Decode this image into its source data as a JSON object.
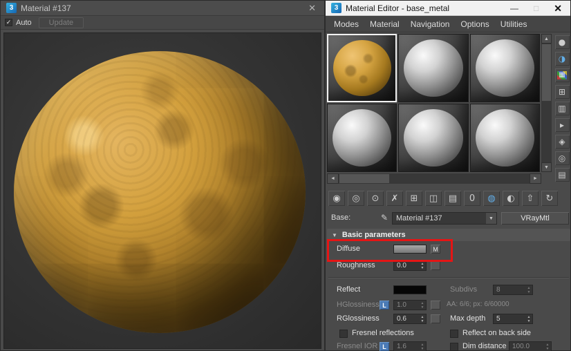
{
  "glyphs": {
    "up": "▲",
    "down": "▼",
    "left": "◄",
    "right": "►",
    "check": "✓",
    "close": "✕",
    "minimize": "—",
    "maximize": "□",
    "eyedropper": "✎",
    "rollout_arrow": "▼"
  },
  "colors": {
    "annotation_red": "#e51515",
    "lock_blue": "#4a7ab5",
    "logo_blue": "#1565b2",
    "sphere_orange": "#d3a03d"
  },
  "preview_window": {
    "logo": "3",
    "title": "Material #137",
    "auto_label": "Auto",
    "update_label": "Update"
  },
  "editor_window": {
    "logo": "3",
    "title": "Material Editor - base_metal",
    "menus": [
      "Modes",
      "Material",
      "Navigation",
      "Options",
      "Utilities"
    ],
    "sample_slots": {
      "count": 6,
      "selected_index": 0
    },
    "side_toolbar": [
      {
        "name": "sample-type",
        "glyph": "●"
      },
      {
        "name": "backlight",
        "glyph": "◑"
      },
      {
        "name": "background",
        "glyph": "▦"
      },
      {
        "name": "sample-uv-tiling",
        "glyph": "⊞"
      },
      {
        "name": "video-color-check",
        "glyph": "▥"
      },
      {
        "name": "make-preview",
        "glyph": "▸"
      },
      {
        "name": "options",
        "glyph": "◈"
      },
      {
        "name": "select-by-material",
        "glyph": "◎"
      },
      {
        "name": "material-map-navigator",
        "glyph": "▤"
      }
    ],
    "top_toolbar": [
      {
        "name": "get-material",
        "glyph": "◉"
      },
      {
        "name": "put-material-to-scene",
        "glyph": "◎"
      },
      {
        "name": "assign-material-to-selection",
        "glyph": "⊙"
      },
      {
        "name": "reset-material",
        "glyph": "✗"
      },
      {
        "name": "make-material-copy",
        "glyph": "⊞"
      },
      {
        "name": "make-unique",
        "glyph": "◫"
      },
      {
        "name": "put-to-library",
        "glyph": "▤"
      },
      {
        "name": "material-id-channel",
        "glyph": "0"
      },
      {
        "name": "show-shaded-material-in-viewport",
        "glyph": "◍"
      },
      {
        "name": "show-end-result",
        "glyph": "◐"
      },
      {
        "name": "go-to-parent",
        "glyph": "⇧"
      },
      {
        "name": "go-forward-to-sibling",
        "glyph": "↻"
      }
    ],
    "base_row": {
      "label": "Base:",
      "material": "Material #137",
      "class_button": "VRayMtl"
    },
    "rollout": {
      "title": "Basic parameters"
    },
    "params": {
      "diffuse": {
        "label": "Diffuse",
        "map": "M"
      },
      "roughness": {
        "label": "Roughness",
        "value": "0.0"
      },
      "reflect": {
        "label": "Reflect"
      },
      "subdivs": {
        "label": "Subdivs",
        "value": "8"
      },
      "hglossiness": {
        "label": "HGlossiness",
        "lock": "L",
        "value": "1.0"
      },
      "aa_info": "AA: 6/6; px: 6/60000",
      "rglossiness": {
        "label": "RGlossiness",
        "value": "0.6"
      },
      "max_depth": {
        "label": "Max depth",
        "value": "5"
      },
      "fresnel_reflections": {
        "label": "Fresnel reflections"
      },
      "reflect_back": {
        "label": "Reflect on back side"
      },
      "fresnel_ior": {
        "label": "Fresnel IOR",
        "lock": "L",
        "value": "1.6"
      },
      "dim_distance": {
        "label": "Dim distance",
        "value": "100.0"
      }
    }
  }
}
